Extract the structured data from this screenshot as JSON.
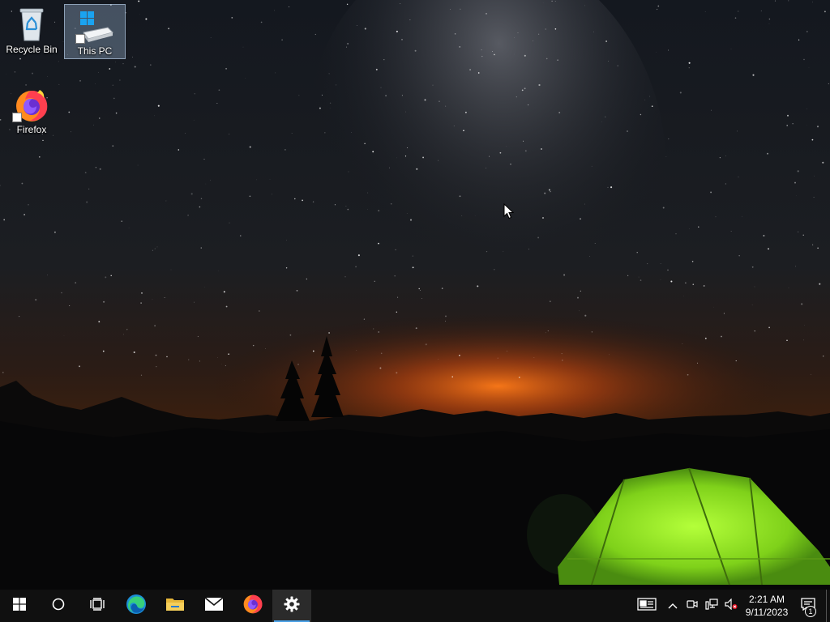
{
  "desktop": {
    "icons": [
      {
        "label": "Recycle Bin",
        "icon": "recycle-bin-icon",
        "selected": false
      },
      {
        "label": "This PC",
        "icon": "this-pc-icon",
        "selected": true
      },
      {
        "label": "Firefox",
        "icon": "firefox-icon",
        "selected": false
      }
    ]
  },
  "taskbar": {
    "pinned": [
      {
        "name": "start",
        "icon": "windows-logo-icon"
      },
      {
        "name": "search",
        "icon": "cortana-circle-icon"
      },
      {
        "name": "task-view",
        "icon": "task-view-icon"
      },
      {
        "name": "edge",
        "icon": "edge-icon"
      },
      {
        "name": "file-explorer",
        "icon": "folder-icon"
      },
      {
        "name": "mail",
        "icon": "mail-icon"
      },
      {
        "name": "firefox",
        "icon": "firefox-icon"
      },
      {
        "name": "settings",
        "icon": "gear-icon",
        "active": true
      }
    ],
    "tray": {
      "icons": [
        "news-and-interests-icon",
        "chevron-up-icon",
        "meet-now-icon",
        "network-icon",
        "volume-muted-icon"
      ],
      "time": "2:21 AM",
      "date": "9/11/2023",
      "notifications_count": "1"
    }
  },
  "colors": {
    "taskbar_bg": "#101010",
    "active_indicator": "#4aa0e6",
    "tent_green": "#8fe81d",
    "horizon_glow": "#ff6a12"
  }
}
